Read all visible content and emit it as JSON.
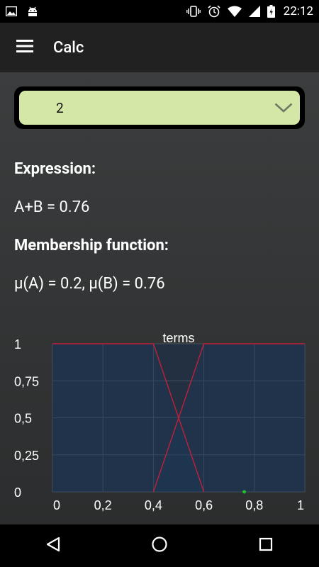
{
  "status_bar": {
    "time": "22:12",
    "left_icons": [
      "image-icon",
      "android-icon"
    ],
    "right_icons": [
      "vibrate-icon",
      "alarm-icon",
      "wifi-icon",
      "signal-icon",
      "battery-icon"
    ]
  },
  "app_bar": {
    "title": "Calc",
    "menu_icon": "menu-icon"
  },
  "spinner": {
    "selected_value": "2",
    "background": "#d4e7a6"
  },
  "expression": {
    "heading": "Expression:",
    "value": "A+B = 0.76"
  },
  "membership": {
    "heading": "Membership function:",
    "value": "μ(A) = 0.2, μ(B) = 0.76"
  },
  "chart_data": {
    "type": "line",
    "title": "terms",
    "x_ticks": [
      "0",
      "0,2",
      "0,4",
      "0,6",
      "0,8",
      "1"
    ],
    "y_ticks": [
      "0",
      "0,25",
      "0,5",
      "0,75",
      "1"
    ],
    "xlim": [
      0,
      1
    ],
    "ylim": [
      0,
      1
    ],
    "grid": true,
    "series": [
      {
        "color": "#c2203a",
        "x": [
          0,
          0.4,
          0.6
        ],
        "y": [
          1,
          1,
          0
        ]
      },
      {
        "color": "#c2203a",
        "x": [
          0.4,
          0.6,
          1
        ],
        "y": [
          0,
          1,
          1
        ]
      }
    ],
    "point": {
      "x": 0.76,
      "y": 0,
      "color": "#1fbf2c"
    }
  },
  "nav_bar": {
    "back_icon": "back-icon",
    "home_icon": "home-icon",
    "recents_icon": "recents-icon"
  }
}
